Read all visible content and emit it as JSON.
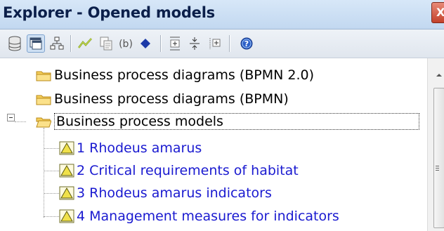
{
  "window": {
    "title": "Explorer - Opened models",
    "close_label": "X"
  },
  "toolbar": {
    "buttons": [
      {
        "icon": "database-icon",
        "pressed": false
      },
      {
        "icon": "windows-icon",
        "pressed": true
      },
      {
        "icon": "hierarchy-icon",
        "pressed": false
      },
      {
        "icon": "connector-icon",
        "pressed": false
      },
      {
        "icon": "copy-document-icon",
        "pressed": false
      },
      {
        "icon": "parenthesis-b-icon",
        "pressed": false
      },
      {
        "icon": "diamond-icon",
        "pressed": false
      },
      {
        "icon": "expand-all-icon",
        "pressed": false
      },
      {
        "icon": "collapse-all-icon",
        "pressed": false
      },
      {
        "icon": "expand-selected-icon",
        "pressed": false
      },
      {
        "icon": "help-icon",
        "pressed": false
      }
    ]
  },
  "tree": {
    "folders": [
      {
        "label": "Business process diagrams (BPMN 2.0)",
        "expanded": false
      },
      {
        "label": "Business process diagrams (BPMN)",
        "expanded": false
      },
      {
        "label": "Business process models",
        "expanded": true,
        "selected": true
      }
    ],
    "models": [
      {
        "label": "1 Rhodeus amarus"
      },
      {
        "label": "2 Critical requirements of habitat"
      },
      {
        "label": "3 Rhodeus amarus indicators"
      },
      {
        "label": "4 Management measures for indicators"
      }
    ]
  },
  "colors": {
    "model_text": "#1a1ad0",
    "folder_fill": "#f5cf5a",
    "model_icon_fill": "#f0e14a",
    "titlebar": "#c9dcf1"
  }
}
